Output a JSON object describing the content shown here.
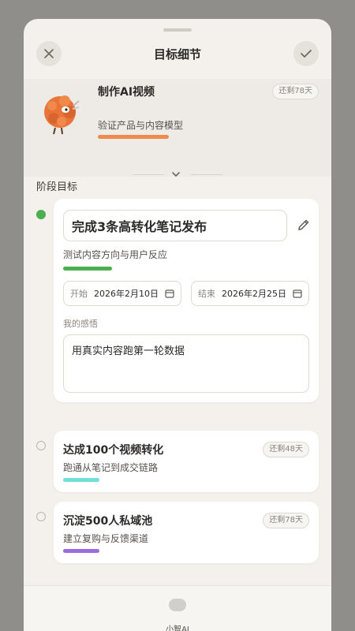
{
  "sheet": {
    "title": "目标细节"
  },
  "goal": {
    "name": "制作AI视频",
    "description": "验证产品与内容模型",
    "remaining": "还剩78天",
    "color": "#f08a4b"
  },
  "stages": {
    "section_title": "阶段目标",
    "active": {
      "title": "完成3条高转化笔记发布",
      "description": "测试内容方向与用户反应",
      "color": "#4bae4f",
      "start_label": "开始",
      "start_date": "2026年2月10日",
      "end_label": "结束",
      "end_date": "2026年2月25日",
      "feel_label": "我的感悟",
      "feel_text": "用真实内容跑第一轮数据"
    },
    "items": [
      {
        "title": "达成100个视频转化",
        "description": "跑通从笔记到成交链路",
        "remaining": "还剩48天",
        "color": "#6fe0dc"
      },
      {
        "title": "沉淀500人私域池",
        "description": "建立复购与反馈渠道",
        "remaining": "还剩78天",
        "color": "#9b6be0"
      }
    ]
  },
  "bottom": {
    "ai_label": "小智AI"
  }
}
